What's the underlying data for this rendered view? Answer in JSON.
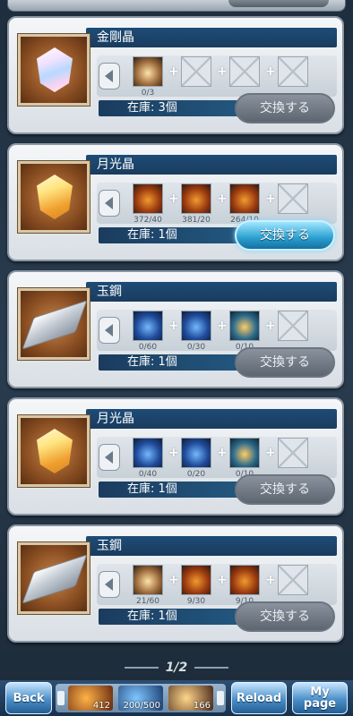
{
  "cards": [
    {
      "title": "金剛晶",
      "icon": "diamond-crystal-icon",
      "stock": "在庫: 3個",
      "button": "交換する",
      "active": false,
      "materials": [
        {
          "count": "0/3",
          "icon": "sword-material-icon",
          "style": "box"
        },
        {
          "count": "",
          "icon": "empty-slot-icon"
        },
        {
          "count": "",
          "icon": "empty-slot-icon"
        },
        {
          "count": "",
          "icon": "empty-slot-icon"
        }
      ]
    },
    {
      "title": "月光晶",
      "icon": "moonlight-crystal-icon",
      "stock": "在庫: 1個",
      "button": "交換する",
      "active": true,
      "materials": [
        {
          "count": "372/40",
          "icon": "fire-material-icon",
          "style": "fire"
        },
        {
          "count": "381/20",
          "icon": "flame-material-icon",
          "style": "fire"
        },
        {
          "count": "264/10",
          "icon": "fire-orb-icon",
          "style": "fire"
        },
        {
          "count": "",
          "icon": "empty-slot-icon"
        }
      ]
    },
    {
      "title": "玉鋼",
      "icon": "ingot-icon",
      "stock": "在庫: 1個",
      "button": "交換する",
      "active": false,
      "materials": [
        {
          "count": "0/60",
          "icon": "water-material-icon",
          "style": "blue"
        },
        {
          "count": "0/30",
          "icon": "water-orb-icon",
          "style": "blue"
        },
        {
          "count": "0/10",
          "icon": "water-essence-icon",
          "style": "teal"
        },
        {
          "count": "",
          "icon": "empty-slot-icon"
        }
      ]
    },
    {
      "title": "月光晶",
      "icon": "moonlight-crystal-icon",
      "stock": "在庫: 1個",
      "button": "交換する",
      "active": false,
      "materials": [
        {
          "count": "0/40",
          "icon": "water-material-icon",
          "style": "blue"
        },
        {
          "count": "0/20",
          "icon": "water-orb-icon",
          "style": "blue"
        },
        {
          "count": "0/10",
          "icon": "water-essence-icon",
          "style": "teal"
        },
        {
          "count": "",
          "icon": "empty-slot-icon"
        }
      ]
    },
    {
      "title": "玉鋼",
      "icon": "ingot-icon",
      "stock": "在庫: 1個",
      "button": "交換する",
      "active": false,
      "materials": [
        {
          "count": "21/60",
          "icon": "sword-material-icon",
          "style": "box"
        },
        {
          "count": "9/30",
          "icon": "fire-orb-icon",
          "style": "fire"
        },
        {
          "count": "9/10",
          "icon": "fire-ring-icon",
          "style": "fire"
        },
        {
          "count": "",
          "icon": "empty-slot-icon"
        }
      ]
    }
  ],
  "pager": "1/2",
  "nav": {
    "back": "Back",
    "reload": "Reload",
    "mypage_line1": "My",
    "mypage_line2": "page",
    "items": [
      {
        "value": "412"
      },
      {
        "value": "200/500"
      },
      {
        "value": "166"
      }
    ]
  }
}
